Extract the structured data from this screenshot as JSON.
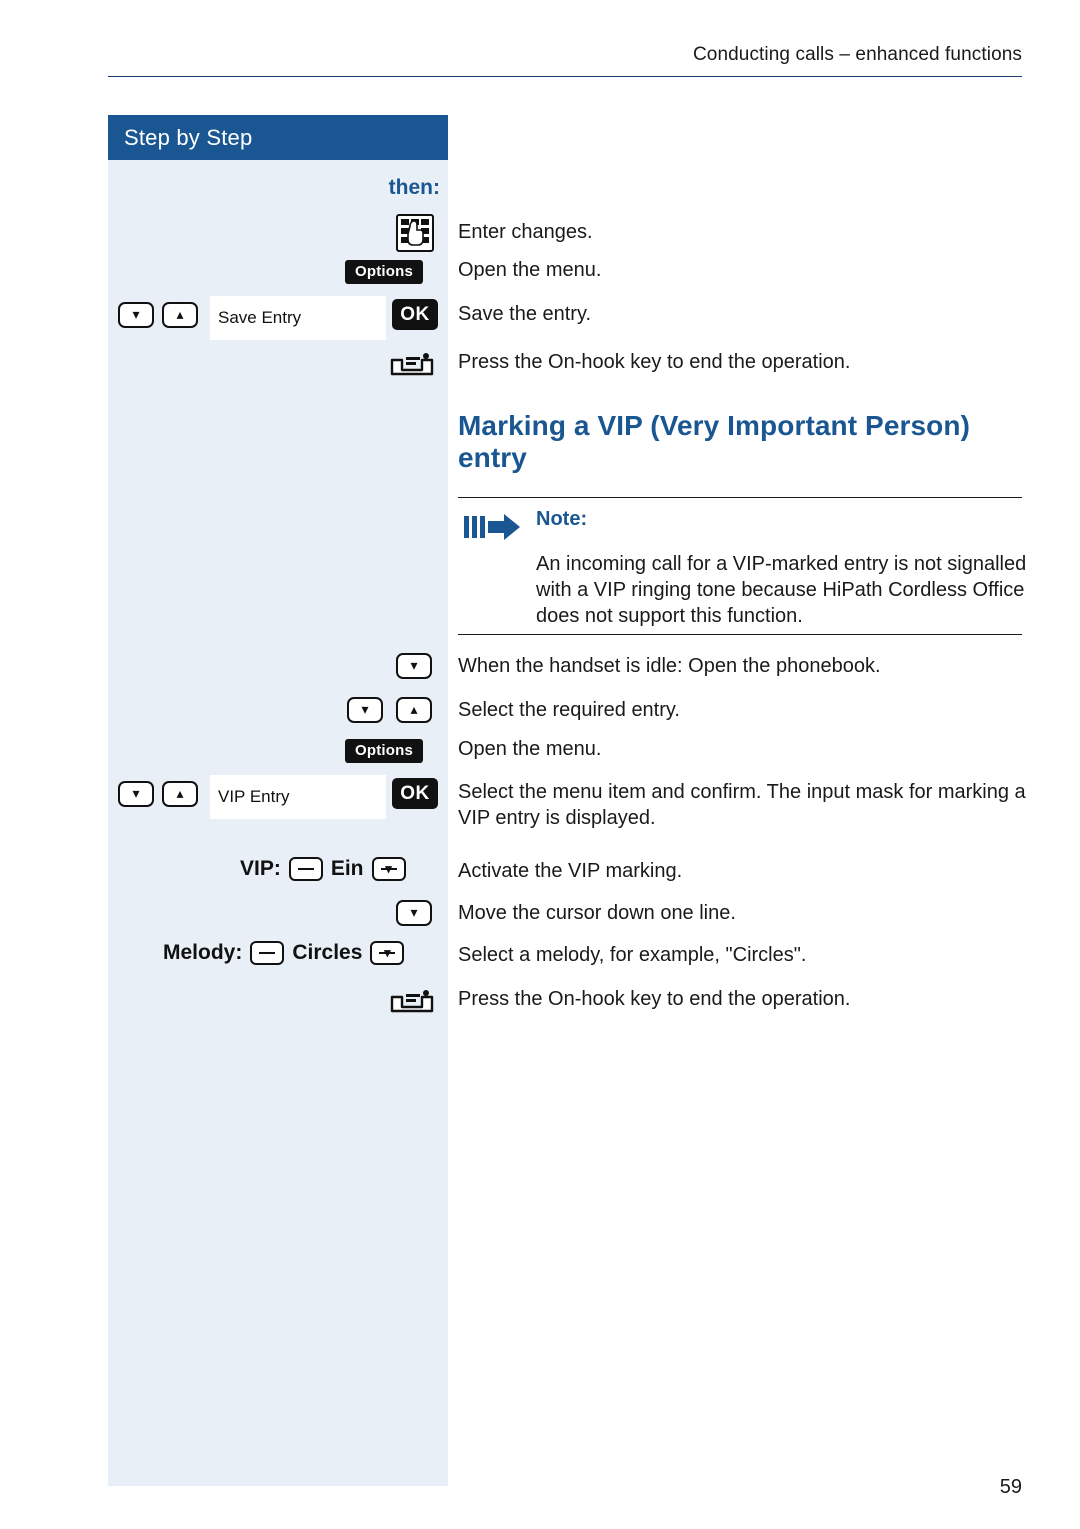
{
  "header": {
    "running_title": "Conducting calls – enhanced functions"
  },
  "sidebar": {
    "title": "Step by Step",
    "then_label": "then:",
    "rows": [
      {
        "icon": "keypad-icon",
        "display": ""
      },
      {
        "icon": "options-pill",
        "display": "Options"
      },
      {
        "icon": "nav-keys",
        "display": "Save Entry",
        "confirm": "OK"
      },
      {
        "icon": "on-hook-key",
        "display": ""
      },
      {
        "icon": "down-key",
        "display": ""
      },
      {
        "icon": "nav-keys",
        "display": ""
      },
      {
        "icon": "options-pill",
        "display": "Options"
      },
      {
        "icon": "nav-keys",
        "display": "VIP Entry",
        "confirm": "OK"
      }
    ],
    "options_label": "Options",
    "save_entry_label": "Save Entry",
    "vip_entry_label": "VIP Entry",
    "ok_label": "OK",
    "vip_field": {
      "label": "VIP:",
      "value": "Ein"
    },
    "melody_field": {
      "label": "Melody:",
      "value": "Circles"
    }
  },
  "instructions": [
    "Enter changes.",
    "Open the menu.",
    "Save the entry.",
    "Press the On-hook key to end the operation.",
    "When the handset is idle: Open the phonebook.",
    "Select the required entry.",
    "Open the menu.",
    "Select the menu item and confirm. The input mask for marking a VIP entry is displayed.",
    "Activate the VIP marking.",
    "Move the cursor down one line.",
    "Select a melody, for example, \"Circles\".",
    "Press the On-hook key to end the operation."
  ],
  "chapter": {
    "heading": "Marking a VIP (Very Important Person) entry"
  },
  "note": {
    "title": "Note:",
    "body": "An incoming call for a VIP-marked entry is not signalled with a VIP ringing tone because HiPath Cordless Office does not support this function."
  },
  "footer": {
    "page_number": "59"
  },
  "colors": {
    "accent_blue": "#1a5792",
    "sidebar_bg": "#e8eff6",
    "text": "#1a1a1a"
  }
}
